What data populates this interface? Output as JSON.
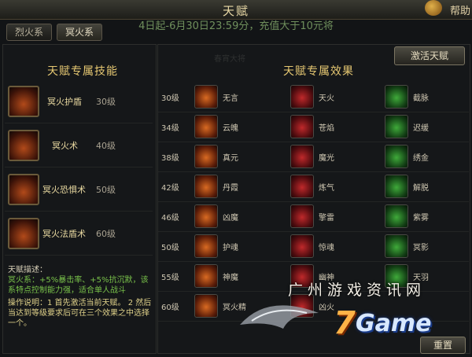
{
  "window": {
    "title": "天赋",
    "corner_text": "帮助"
  },
  "banner": "4日起-6月30日23:59分，充值大于10元将",
  "tabs": [
    {
      "label": "烈火系"
    },
    {
      "label": "冥火系"
    }
  ],
  "watermark": "春宵大将",
  "left_title": "天赋专属技能",
  "right_title": "天赋专属效果",
  "activate_label": "激活天赋",
  "skills": [
    {
      "name": "冥火护盾",
      "level": "30级"
    },
    {
      "name": "冥火术",
      "level": "40级"
    },
    {
      "name": "冥火恐惧术",
      "level": "50级"
    },
    {
      "name": "冥火法盾术",
      "level": "60级"
    }
  ],
  "description": {
    "heading": "天赋描述：",
    "body": "冥火系：+5%暴击率、+5%抗沉默，该系特点控制能力强，适合单人战斗",
    "instructions": "操作说明：1 首先激活当前天赋。 2 然后当达到等级要求后可在三个效果之中选择一个。"
  },
  "effects": [
    {
      "level": "30级",
      "options": [
        "无言",
        "天火",
        "截脉"
      ]
    },
    {
      "level": "34级",
      "options": [
        "云魄",
        "苍焰",
        "迟缓"
      ]
    },
    {
      "level": "38级",
      "options": [
        "真元",
        "魔光",
        "绣金"
      ]
    },
    {
      "level": "42级",
      "options": [
        "丹霞",
        "炼气",
        "解脱"
      ]
    },
    {
      "level": "46级",
      "options": [
        "凶魔",
        "擎雷",
        "紫雾"
      ]
    },
    {
      "level": "50级",
      "options": [
        "护魂",
        "惊魂",
        "冥影"
      ]
    },
    {
      "level": "55级",
      "options": [
        "神魔",
        "幽神",
        "天羽"
      ]
    },
    {
      "level": "60级",
      "options": [
        "冥火精",
        "凶火",
        ""
      ]
    }
  ],
  "overlay": {
    "site_mark": "广州游戏资讯网",
    "logo_digit": "7",
    "logo_word": "Game"
  },
  "reset_label": "重置",
  "colors": {
    "accent_gold": "#e6c872",
    "green_text": "#79c24a",
    "yellow_text": "#e0d28a",
    "banner_green": "#6f8f5c"
  }
}
